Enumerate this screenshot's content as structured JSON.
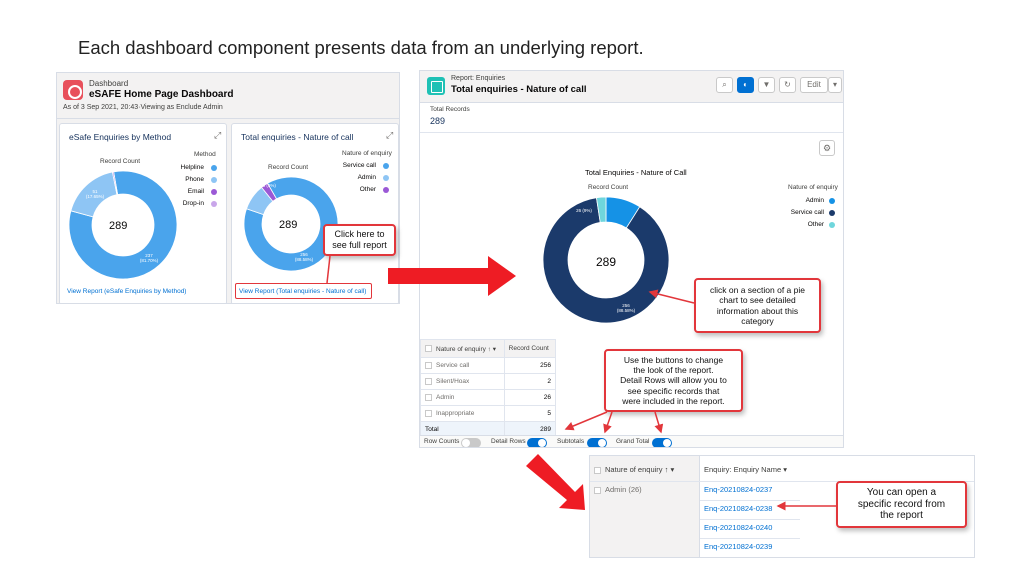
{
  "heading": "Each dashboard component presents data from an underlying report.",
  "dashboard": {
    "kicker": "Dashboard",
    "title": "eSAFE Home Page Dashboard",
    "subtitle": "As of 3 Sep 2021, 20:43·Viewing as Enclude Admin",
    "cards": [
      {
        "title": "eSafe Enquiries by Method",
        "record_count_label": "Record Count",
        "legend_title": "Method",
        "legend": [
          "Helpline",
          "Phone",
          "Email",
          "Drop-in"
        ],
        "center": "289",
        "slice_labels": [
          "51 (17.65%)",
          "237 (81.70%)"
        ],
        "link": "View Report (eSafe Enquiries by Method)"
      },
      {
        "title": "Total enquiries - Nature of call",
        "record_count_label": "Record Count",
        "legend_title": "Nature of enquiry",
        "legend": [
          "Service call",
          "Admin",
          "Other"
        ],
        "center": "289",
        "slice_labels": [
          "26 (9%)",
          "256 (88.58%)"
        ],
        "link": "View Report (Total enquiries - Nature of call)"
      }
    ]
  },
  "report": {
    "kicker": "Report: Enquiries",
    "title": "Total enquiries - Nature of call",
    "edit_label": "Edit",
    "total_records_label": "Total Records",
    "total_records": "289",
    "chart_title": "Total Enquiries - Nature of Call",
    "chart_sub": "Record Count",
    "legend_title": "Nature of enquiry",
    "legend": [
      "Admin",
      "Service call",
      "Other"
    ],
    "center": "289",
    "slice_labels": [
      "26 (9%)",
      "256 (88.58%)"
    ],
    "table": {
      "headers": [
        "Nature of enquiry",
        "Record Count"
      ],
      "rows": [
        [
          "Service call",
          "256"
        ],
        [
          "Silent/Hoax",
          "2"
        ],
        [
          "Admin",
          "26"
        ],
        [
          "Inappropriate",
          "5"
        ]
      ],
      "total": [
        "Total",
        "289"
      ]
    },
    "toggles": [
      "Row Counts",
      "Detail Rows",
      "Subtotals",
      "Grand Total"
    ]
  },
  "detail": {
    "headers": [
      "Nature of enquiry",
      "Enquiry: Enquiry Name"
    ],
    "group": "Admin (26)",
    "records": [
      "Enq-20210824-0237",
      "Enq-20210824-0238",
      "Enq-20210824-0240",
      "Enq-20210824-0239"
    ]
  },
  "callouts": {
    "click_here": [
      "Click here to",
      "see full report"
    ],
    "pie_click": [
      "click on a section of a pie",
      "chart to see detailed",
      "information about this",
      "category"
    ],
    "buttons": [
      "Use the buttons to change",
      "the look of the report.",
      "Detail Rows will allow you to",
      "see specific records that",
      "were included in the report."
    ],
    "open_record": [
      "You can open a",
      "specific record from",
      "the report"
    ]
  },
  "chart_data": [
    {
      "type": "pie",
      "title": "eSafe Enquiries by Method",
      "categories": [
        "Helpline",
        "Phone",
        "Email",
        "Drop-in"
      ],
      "values": [
        237,
        51,
        1,
        0
      ],
      "total": 289
    },
    {
      "type": "pie",
      "title": "Total enquiries - Nature of call",
      "categories": [
        "Service call",
        "Admin",
        "Other"
      ],
      "values": [
        256,
        26,
        7
      ],
      "total": 289
    },
    {
      "type": "pie",
      "title": "Total Enquiries - Nature of Call",
      "categories": [
        "Admin",
        "Service call",
        "Other"
      ],
      "values": [
        26,
        256,
        7
      ],
      "total": 289
    }
  ],
  "colors": {
    "helpline": "#4aa4ec",
    "phone": "#8ec5f4",
    "email": "#9b59d6",
    "dropin": "#c9a6ea",
    "service_call": "#1b3a6b",
    "admin": "#1592e6",
    "other": "#6fd6dc",
    "accent_red": "#e2363b",
    "link_blue": "#0070d2"
  }
}
